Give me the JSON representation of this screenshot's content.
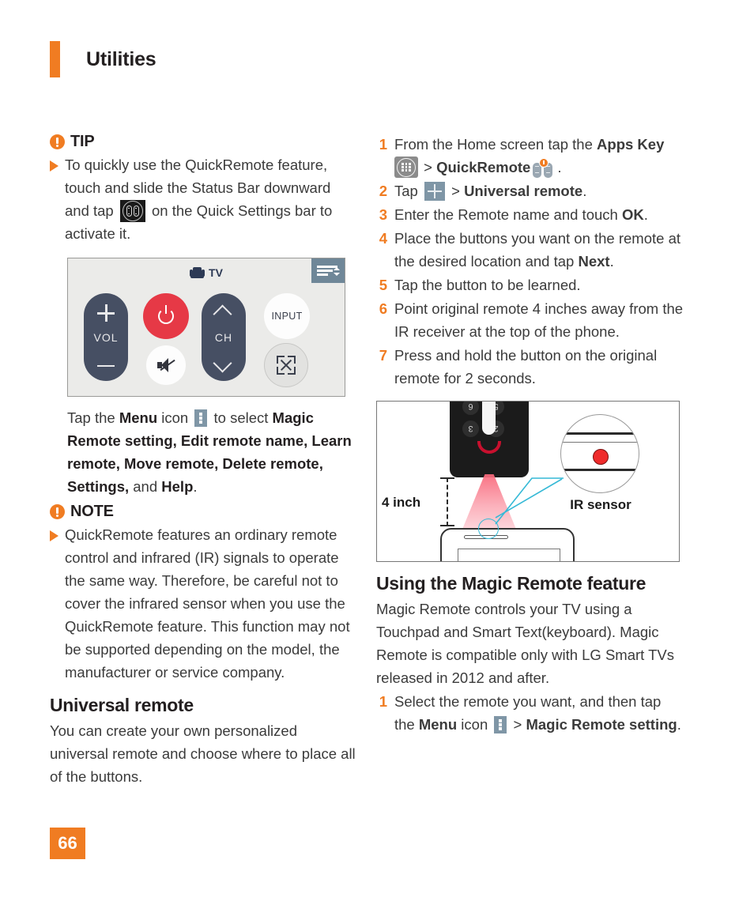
{
  "header": {
    "title": "Utilities",
    "accent_color": "#f07c22"
  },
  "left_column": {
    "tip": {
      "label": "TIP",
      "text_parts": {
        "p1": "To quickly use the QuickRemote feature, touch and slide the Status Bar downward and tap ",
        "p2": " on the Quick Settings bar to activate it."
      }
    },
    "remote_figure": {
      "tv_label": "TV",
      "vol_label": "VOL",
      "ch_label": "CH",
      "input_label": "INPUT",
      "power_color": "#e63946",
      "pill_color": "#464f63",
      "background_color": "#ebebe9",
      "tab_color": "#6f8798"
    },
    "menu_paragraph": {
      "t1": "Tap the ",
      "b1": "Menu",
      "t2": " icon ",
      "t3": " to select ",
      "b2": "Magic Remote setting, Edit remote name, Learn remote, Move remote, Delete remote, Settings,",
      "t4": " and ",
      "b3": "Help",
      "t5": "."
    },
    "note": {
      "label": "NOTE",
      "text": "QuickRemote features an ordinary remote control and infrared (IR) signals to operate the same way. Therefore, be careful not to cover the infrared sensor when you use the QuickRemote feature. This function may not be supported depending on the model, the manufacturer or service company."
    },
    "universal_remote": {
      "heading": "Universal remote",
      "body": "You can create your own personalized universal remote and choose where to place all of the buttons."
    }
  },
  "right_column": {
    "steps": {
      "s1": {
        "num": "1",
        "t1": "From the Home screen tap the ",
        "b1": "Apps Key",
        "t2": " > ",
        "b2": "QuickRemote",
        "t3": "."
      },
      "s2": {
        "num": "2",
        "t1": "Tap ",
        "t2": " > ",
        "b1": "Universal remote",
        "t3": "."
      },
      "s3": {
        "num": "3",
        "t1": "Enter the Remote name and touch ",
        "b1": "OK",
        "t2": "."
      },
      "s4": {
        "num": "4",
        "t1": "Place the buttons you want on the remote at the desired location and tap ",
        "b1": "Next",
        "t2": "."
      },
      "s5": {
        "num": "5",
        "t1": "Tap the button to be learned."
      },
      "s6": {
        "num": "6",
        "t1": "Point original remote 4 inches away from the IR receiver at the top of the phone."
      },
      "s7": {
        "num": "7",
        "t1": "Press and hold the button on the original remote for 2 seconds."
      }
    },
    "ir_figure": {
      "distance_label": "4 inch",
      "sensor_label": "IR sensor",
      "keys": [
        "6",
        "5",
        "3",
        "2"
      ],
      "beam_color": "#f9677a",
      "sensor_dot_color": "#ef2b2b",
      "leader_color": "#35b9d6"
    },
    "magic_remote": {
      "heading": "Using the Magic Remote feature",
      "body": "Magic Remote controls your TV using a Touchpad and Smart Text(keyboard). Magic Remote is compatible only with LG Smart TVs released in 2012 and after.",
      "step": {
        "num": "1",
        "t1": "Select the remote you want, and then tap the ",
        "b1": "Menu",
        "t2": " icon ",
        "t3": " > ",
        "b2": "Magic Remote setting",
        "t4": "."
      }
    }
  },
  "footer": {
    "page_number": "66"
  }
}
